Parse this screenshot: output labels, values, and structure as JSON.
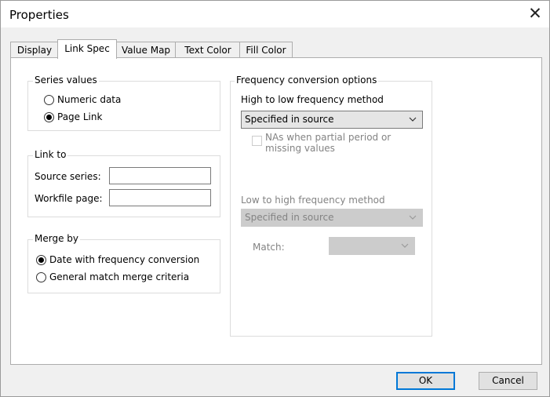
{
  "window": {
    "title": "Properties"
  },
  "tabs": [
    {
      "label": "Display"
    },
    {
      "label": "Link Spec",
      "active": true
    },
    {
      "label": "Value Map"
    },
    {
      "label": "Text Color"
    },
    {
      "label": "Fill Color"
    }
  ],
  "series_values": {
    "title": "Series values",
    "options": [
      {
        "label": "Numeric data",
        "selected": false
      },
      {
        "label": "Page Link",
        "selected": true
      }
    ]
  },
  "link_to": {
    "title": "Link to",
    "source_series_label": "Source series:",
    "source_series_value": "",
    "workfile_page_label": "Workfile page:",
    "workfile_page_value": ""
  },
  "merge_by": {
    "title": "Merge by",
    "options": [
      {
        "label": "Date with frequency conversion",
        "selected": true
      },
      {
        "label": "General match merge criteria",
        "selected": false
      }
    ]
  },
  "frequency": {
    "title": "Frequency conversion options",
    "high_to_low_label": "High to low frequency method",
    "high_to_low_value": "Specified in source",
    "nas_line1": "NAs when partial period or",
    "nas_line2": "missing values",
    "nas_checked": false,
    "low_to_high_label": "Low to high frequency method",
    "low_to_high_value": "Specified in source",
    "match_label": "Match:",
    "match_value": ""
  },
  "buttons": {
    "ok": "OK",
    "cancel": "Cancel"
  },
  "icons": {
    "close": "close-icon",
    "dropdown": "chevron-down-icon"
  }
}
